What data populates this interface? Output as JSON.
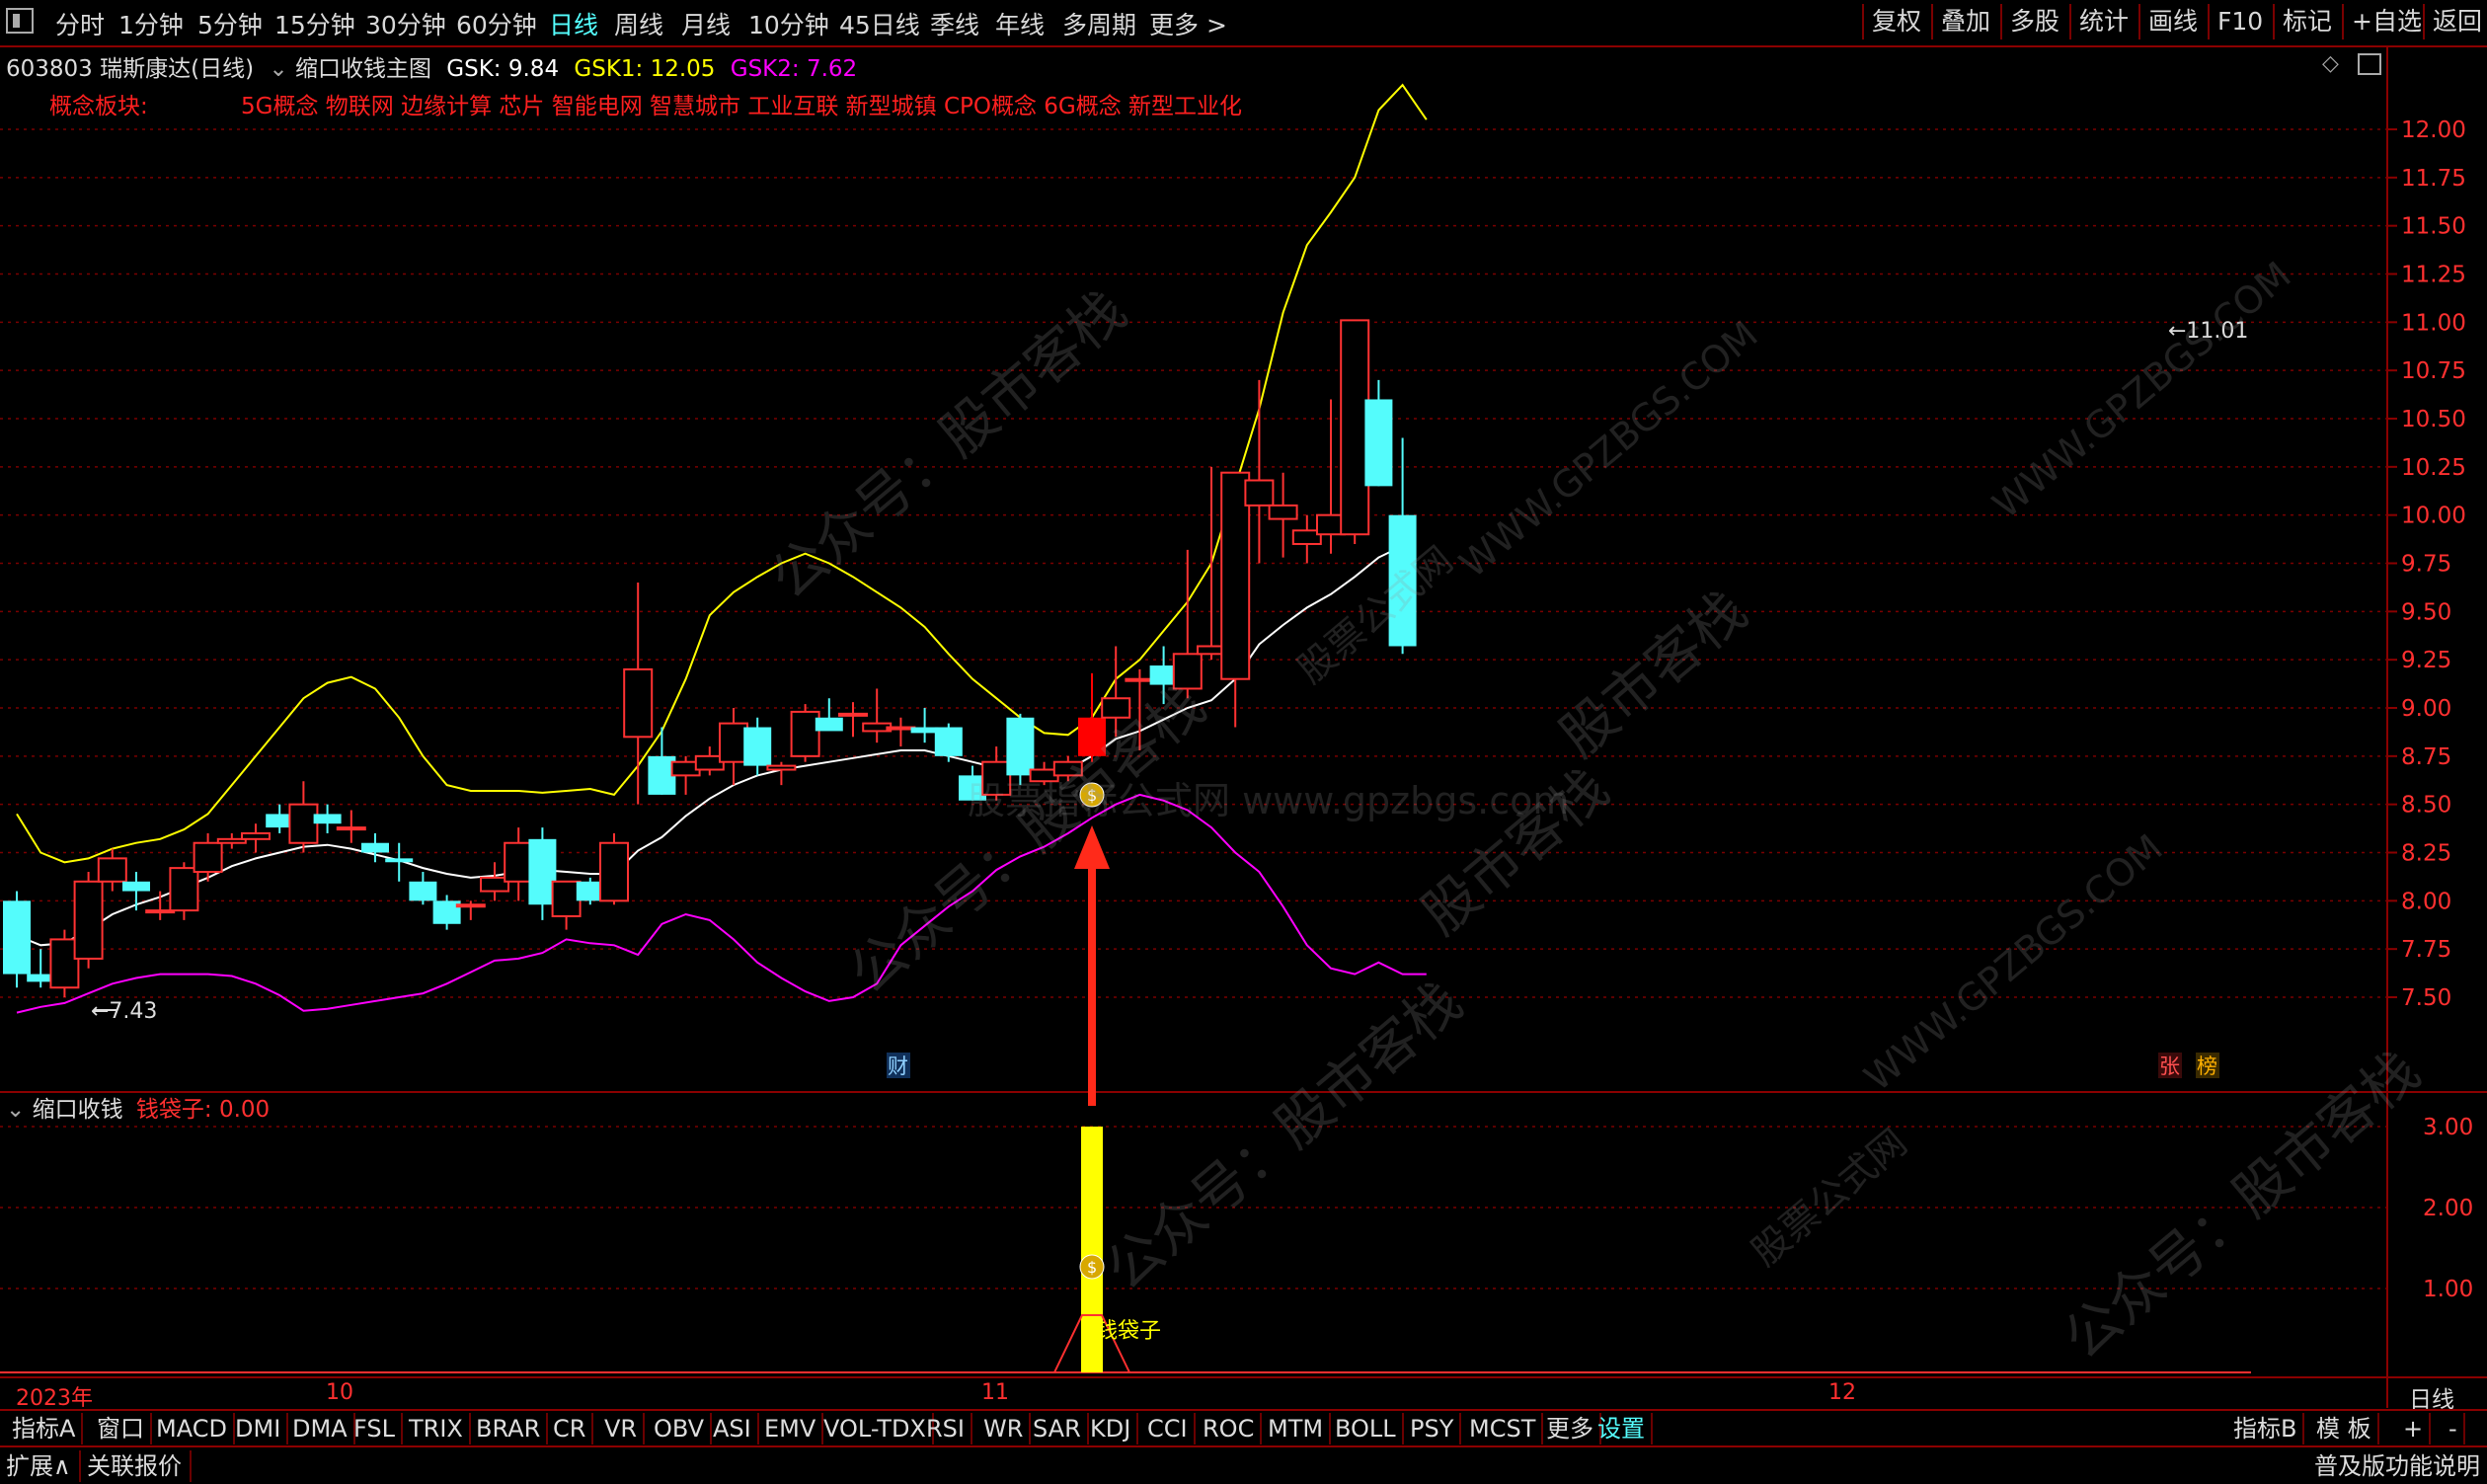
{
  "topbar": {
    "tabs": [
      "分时",
      "1分钟",
      "5分钟",
      "15分钟",
      "30分钟",
      "60分钟",
      "日线",
      "周线",
      "月线",
      "10分钟",
      "45日线",
      "季线",
      "年线",
      "多周期",
      "更多 >"
    ],
    "active_tab": "日线",
    "right_buttons": [
      "复权",
      "叠加",
      "多股",
      "统计",
      "画线",
      "F10",
      "标记",
      "+自选",
      "返回"
    ]
  },
  "header": {
    "code": "603803",
    "name": "瑞斯康达(日线)",
    "indicator": "缩口收钱主图",
    "gsk": "GSK: 9.84",
    "gsk1": "GSK1: 12.05",
    "gsk2": "GSK2: 7.62",
    "concept_label": "概念板块:",
    "concepts": "5G概念 物联网 边缘计算 芯片 智能电网 智慧城市 工业互联 新型城镇 CPO概念 6G概念 新型工业化"
  },
  "main_chart": {
    "price_ticks": [
      "12.00",
      "11.75",
      "11.50",
      "11.25",
      "11.00",
      "10.75",
      "10.50",
      "10.25",
      "10.00",
      "9.75",
      "9.50",
      "9.25",
      "9.00",
      "8.75",
      "8.50",
      "8.25",
      "8.00",
      "7.75",
      "7.50"
    ],
    "low_label": "7.43",
    "high_label": "11.01",
    "marker_cai": "财",
    "marker_zhang": "张",
    "marker_bang": "榜",
    "colors": {
      "up": "#ff3232",
      "down": "#54fcfc",
      "gsk": "#ffffff",
      "gsk1": "#ffff00",
      "gsk2": "#ff00ff",
      "signal": "#ff0000"
    }
  },
  "chart_data": {
    "type": "candlestick",
    "ylim": [
      7.25,
      12.25
    ],
    "candles": [
      {
        "o": 8.0,
        "h": 8.05,
        "l": 7.55,
        "c": 7.62
      },
      {
        "o": 7.62,
        "h": 7.75,
        "l": 7.55,
        "c": 7.58
      },
      {
        "o": 7.55,
        "h": 7.85,
        "l": 7.5,
        "c": 7.8
      },
      {
        "o": 7.7,
        "h": 8.15,
        "l": 7.65,
        "c": 8.1
      },
      {
        "o": 8.1,
        "h": 8.27,
        "l": 8.05,
        "c": 8.22
      },
      {
        "o": 8.1,
        "h": 8.15,
        "l": 7.95,
        "c": 8.05
      },
      {
        "o": 7.95,
        "h": 8.05,
        "l": 7.9,
        "c": 7.95
      },
      {
        "o": 7.95,
        "h": 8.2,
        "l": 7.9,
        "c": 8.17
      },
      {
        "o": 8.15,
        "h": 8.35,
        "l": 8.1,
        "c": 8.3
      },
      {
        "o": 8.3,
        "h": 8.35,
        "l": 8.27,
        "c": 8.32
      },
      {
        "o": 8.32,
        "h": 8.4,
        "l": 8.25,
        "c": 8.35
      },
      {
        "o": 8.45,
        "h": 8.5,
        "l": 8.35,
        "c": 8.38
      },
      {
        "o": 8.3,
        "h": 8.62,
        "l": 8.25,
        "c": 8.5
      },
      {
        "o": 8.45,
        "h": 8.5,
        "l": 8.35,
        "c": 8.4
      },
      {
        "o": 8.38,
        "h": 8.47,
        "l": 8.3,
        "c": 8.38
      },
      {
        "o": 8.3,
        "h": 8.35,
        "l": 8.2,
        "c": 8.25
      },
      {
        "o": 8.22,
        "h": 8.3,
        "l": 8.1,
        "c": 8.2
      },
      {
        "o": 8.1,
        "h": 8.15,
        "l": 7.98,
        "c": 8.0
      },
      {
        "o": 8.0,
        "h": 8.03,
        "l": 7.85,
        "c": 7.88
      },
      {
        "o": 7.98,
        "h": 8.0,
        "l": 7.9,
        "c": 7.98
      },
      {
        "o": 8.05,
        "h": 8.2,
        "l": 8.0,
        "c": 8.12
      },
      {
        "o": 8.1,
        "h": 8.38,
        "l": 8.0,
        "c": 8.3
      },
      {
        "o": 8.32,
        "h": 8.38,
        "l": 7.9,
        "c": 7.98
      },
      {
        "o": 7.92,
        "h": 8.1,
        "l": 7.85,
        "c": 8.1
      },
      {
        "o": 8.1,
        "h": 8.12,
        "l": 7.98,
        "c": 8.0
      },
      {
        "o": 8.0,
        "h": 8.35,
        "l": 7.98,
        "c": 8.3
      },
      {
        "o": 8.85,
        "h": 9.65,
        "l": 8.5,
        "c": 9.2
      },
      {
        "o": 8.75,
        "h": 8.9,
        "l": 8.55,
        "c": 8.55
      },
      {
        "o": 8.65,
        "h": 8.75,
        "l": 8.55,
        "c": 8.72
      },
      {
        "o": 8.68,
        "h": 8.8,
        "l": 8.65,
        "c": 8.75
      },
      {
        "o": 8.72,
        "h": 9.0,
        "l": 8.6,
        "c": 8.92
      },
      {
        "o": 8.9,
        "h": 8.95,
        "l": 8.65,
        "c": 8.7
      },
      {
        "o": 8.68,
        "h": 8.72,
        "l": 8.6,
        "c": 8.7
      },
      {
        "o": 8.75,
        "h": 9.02,
        "l": 8.72,
        "c": 8.98
      },
      {
        "o": 8.95,
        "h": 9.05,
        "l": 8.9,
        "c": 8.88
      },
      {
        "o": 8.97,
        "h": 9.03,
        "l": 8.85,
        "c": 8.97
      },
      {
        "o": 8.88,
        "h": 9.1,
        "l": 8.82,
        "c": 8.92
      },
      {
        "o": 8.9,
        "h": 8.95,
        "l": 8.8,
        "c": 8.9
      },
      {
        "o": 8.9,
        "h": 9.0,
        "l": 8.82,
        "c": 8.87
      },
      {
        "o": 8.9,
        "h": 8.92,
        "l": 8.72,
        "c": 8.75
      },
      {
        "o": 8.65,
        "h": 8.7,
        "l": 8.52,
        "c": 8.52
      },
      {
        "o": 8.55,
        "h": 8.8,
        "l": 8.52,
        "c": 8.72
      },
      {
        "o": 8.95,
        "h": 8.97,
        "l": 8.6,
        "c": 8.65
      },
      {
        "o": 8.62,
        "h": 8.72,
        "l": 8.6,
        "c": 8.68
      },
      {
        "o": 8.65,
        "h": 8.75,
        "l": 8.62,
        "c": 8.72
      },
      {
        "o": 8.75,
        "h": 9.18,
        "l": 8.72,
        "c": 8.95
      },
      {
        "o": 8.95,
        "h": 9.32,
        "l": 8.85,
        "c": 9.05
      },
      {
        "o": 9.15,
        "h": 9.2,
        "l": 8.78,
        "c": 9.15
      },
      {
        "o": 9.22,
        "h": 9.32,
        "l": 9.02,
        "c": 9.12
      },
      {
        "o": 9.1,
        "h": 9.82,
        "l": 9.05,
        "c": 9.28
      },
      {
        "o": 9.28,
        "h": 10.25,
        "l": 9.25,
        "c": 9.32
      },
      {
        "o": 9.15,
        "h": 10.22,
        "l": 8.9,
        "c": 10.22
      },
      {
        "o": 10.05,
        "h": 10.7,
        "l": 9.75,
        "c": 10.18
      },
      {
        "o": 9.98,
        "h": 10.22,
        "l": 9.78,
        "c": 10.05
      },
      {
        "o": 9.85,
        "h": 10.0,
        "l": 9.75,
        "c": 9.92
      },
      {
        "o": 9.9,
        "h": 10.6,
        "l": 9.8,
        "c": 10.0
      },
      {
        "o": 9.9,
        "h": 11.01,
        "l": 9.85,
        "c": 11.01
      },
      {
        "o": 10.6,
        "h": 10.7,
        "l": 10.15,
        "c": 10.15
      },
      {
        "o": 10.0,
        "h": 10.4,
        "l": 9.28,
        "c": 9.32
      }
    ],
    "gsk": [
      7.82,
      7.77,
      7.78,
      7.85,
      7.93,
      7.98,
      8.02,
      8.07,
      8.12,
      8.18,
      8.22,
      8.25,
      8.28,
      8.29,
      8.27,
      8.24,
      8.21,
      8.17,
      8.14,
      8.12,
      8.13,
      8.15,
      8.16,
      8.15,
      8.14,
      8.14,
      8.26,
      8.33,
      8.44,
      8.53,
      8.6,
      8.65,
      8.68,
      8.7,
      8.72,
      8.74,
      8.76,
      8.78,
      8.78,
      8.75,
      8.72,
      8.69,
      8.67,
      8.67,
      8.68,
      8.75,
      8.84,
      8.88,
      8.94,
      9.0,
      9.04,
      9.15,
      9.33,
      9.43,
      9.52,
      9.59,
      9.68,
      9.78,
      9.84
    ],
    "gsk1": [
      8.45,
      8.25,
      8.2,
      8.22,
      8.27,
      8.3,
      8.32,
      8.37,
      8.45,
      8.6,
      8.75,
      8.9,
      9.05,
      9.13,
      9.16,
      9.1,
      8.95,
      8.75,
      8.6,
      8.57,
      8.57,
      8.57,
      8.56,
      8.57,
      8.58,
      8.55,
      8.7,
      8.88,
      9.15,
      9.48,
      9.6,
      9.68,
      9.75,
      9.8,
      9.75,
      9.68,
      9.6,
      9.52,
      9.42,
      9.28,
      9.15,
      9.05,
      8.95,
      8.87,
      8.86,
      8.95,
      9.15,
      9.25,
      9.4,
      9.55,
      9.75,
      10.15,
      10.55,
      11.05,
      11.4,
      11.57,
      11.75,
      12.1,
      12.23,
      12.05
    ],
    "gsk2": [
      7.42,
      7.45,
      7.47,
      7.52,
      7.57,
      7.6,
      7.62,
      7.62,
      7.62,
      7.61,
      7.57,
      7.51,
      7.43,
      7.44,
      7.46,
      7.48,
      7.5,
      7.52,
      7.57,
      7.63,
      7.69,
      7.7,
      7.73,
      7.8,
      7.78,
      7.77,
      7.72,
      7.88,
      7.93,
      7.9,
      7.8,
      7.68,
      7.6,
      7.53,
      7.48,
      7.5,
      7.57,
      7.77,
      7.87,
      7.97,
      8.05,
      8.16,
      8.23,
      8.28,
      8.35,
      8.43,
      8.5,
      8.55,
      8.52,
      8.47,
      8.38,
      8.25,
      8.15,
      7.97,
      7.77,
      7.65,
      7.62,
      7.68,
      7.62,
      7.62
    ],
    "signal_index": 45
  },
  "sub_chart": {
    "title": "缩口收钱",
    "value_label": "钱袋子: 0.00",
    "ticks": [
      "3.00",
      "2.00",
      "1.00"
    ],
    "ylim": [
      0,
      3.5
    ],
    "bar_value": 3.0,
    "signal_label": "钱袋子"
  },
  "date_axis": {
    "labels": [
      "2023年",
      "10",
      "11",
      "12"
    ],
    "period": "日线"
  },
  "indicator_bar": {
    "items": [
      "指标A",
      "窗口",
      "MACD",
      "DMI",
      "DMA",
      "FSL",
      "TRIX",
      "BRAR",
      "CR",
      "VR",
      "OBV",
      "ASI",
      "EMV",
      "VOL-TDX",
      "RSI",
      "WR",
      "SAR",
      "KDJ",
      "CCI",
      "ROC",
      "MTM",
      "BOLL",
      "PSY",
      "MCST",
      "更多",
      "设置"
    ],
    "right": [
      "指标B",
      "模 板",
      "+",
      "-"
    ]
  },
  "status_bar": {
    "left": [
      "扩展∧",
      "关联报价"
    ],
    "right": "普及版功能说明"
  },
  "watermarks": [
    "公众号：股市客栈",
    "WWW.GPZBGS.COM",
    "股票公式网",
    "股市客栈",
    "股票指标公式网 www.gpzbgs.com"
  ]
}
